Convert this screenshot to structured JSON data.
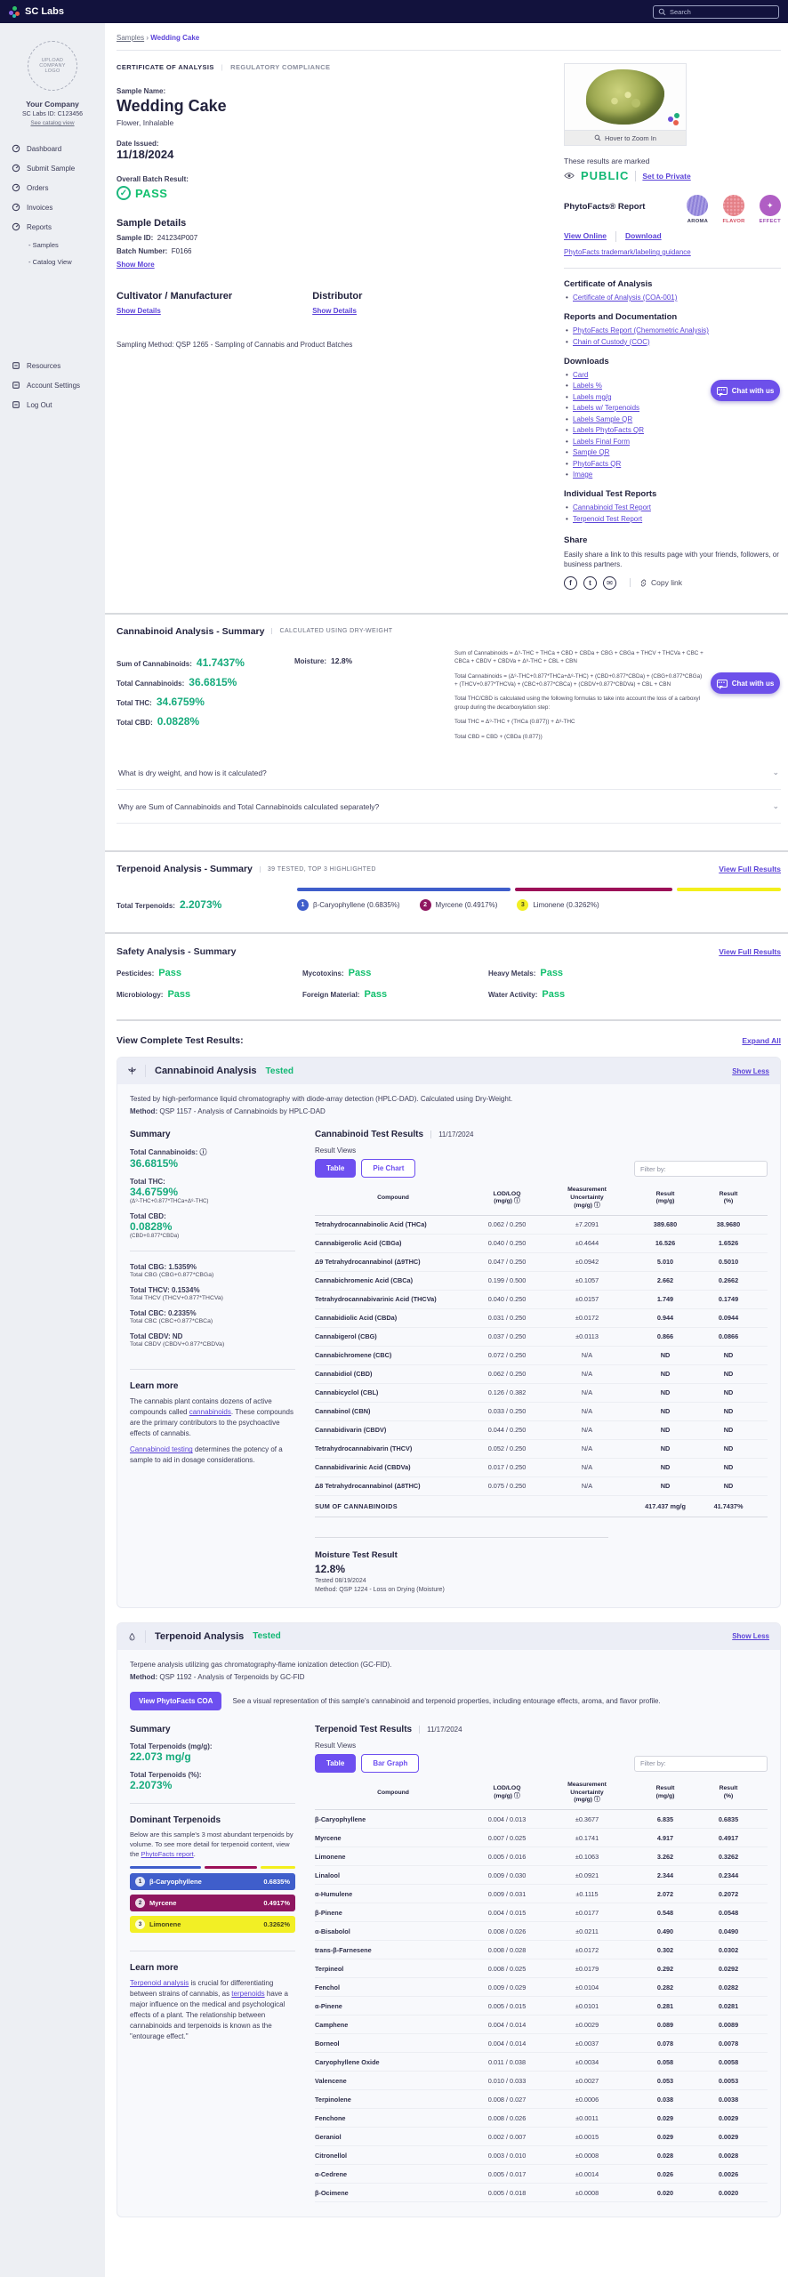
{
  "topbar": {
    "brand": "SC Labs",
    "search_placeholder": "Search"
  },
  "sidebar": {
    "upload_logo": "UPLOAD\nCOMPANY\nLOGO",
    "company": "Your Company",
    "labs_id": "SC Labs ID: C123456",
    "catalog_link": "See catalog view",
    "nav": [
      {
        "label": "Dashboard",
        "icon": "dashboard-icon"
      },
      {
        "label": "Submit Sample",
        "icon": "submit-sample-icon"
      },
      {
        "label": "Orders",
        "icon": "orders-icon"
      },
      {
        "label": "Invoices",
        "icon": "invoices-icon"
      },
      {
        "label": "Reports",
        "icon": "reports-icon"
      }
    ],
    "subnav": [
      {
        "label": "- Samples"
      },
      {
        "label": "- Catalog View"
      }
    ],
    "bottom": [
      {
        "label": "Resources"
      },
      {
        "label": "Account Settings"
      },
      {
        "label": "Log Out"
      }
    ]
  },
  "breadcrumb": {
    "parent": "Samples",
    "sep": "›",
    "current": "Wedding Cake"
  },
  "tabs": {
    "coa": "CERTIFICATE OF ANALYSIS",
    "reg": "REGULATORY COMPLIANCE"
  },
  "sample": {
    "name_label": "Sample Name:",
    "name": "Wedding Cake",
    "type": "Flower, Inhalable",
    "date_issued_label": "Date Issued:",
    "date_issued": "11/18/2024",
    "batch_result_label": "Overall Batch Result:",
    "batch_result": "PASS",
    "details_title": "Sample Details",
    "sample_id_label": "Sample ID:",
    "sample_id": "241234P007",
    "batch_number_label": "Batch Number:",
    "batch_number": "F0166",
    "show_more": "Show More",
    "cultivator_title": "Cultivator / Manufacturer",
    "distributor_title": "Distributor",
    "show_details": "Show Details",
    "sampling_method": "Sampling Method: QSP 1265 - Sampling of Cannabis and Product Batches"
  },
  "right_rail": {
    "hover_zoom": "Hover to Zoom In",
    "marked_label": "These results are marked",
    "visibility": "PUBLIC",
    "set_private": "Set to Private",
    "phytofacts_title": "PhytoFacts® Report",
    "profile_circles": [
      {
        "label": "AROMA"
      },
      {
        "label": "FLAVOR"
      },
      {
        "label": "EFFECT"
      }
    ],
    "view_online": "View Online",
    "download": "Download",
    "guidance_link": "PhytoFacts trademark/labeling guidance",
    "coa_title": "Certificate of Analysis",
    "coa_links": [
      {
        "label": "Certificate of Analysis (COA-001)"
      }
    ],
    "docs_title": "Reports and Documentation",
    "docs_links": [
      {
        "label": "PhytoFacts Report (Chemometric Analysis)"
      },
      {
        "label": "Chain of Custody (COC)"
      }
    ],
    "downloads_title": "Downloads",
    "downloads": [
      {
        "label": "Card"
      },
      {
        "label": "Labels %"
      },
      {
        "label": "Labels mg/g"
      },
      {
        "label": "Labels w/ Terpenoids"
      },
      {
        "label": "Labels Sample QR"
      },
      {
        "label": "Labels PhytoFacts QR"
      },
      {
        "label": "Labels Final Form"
      },
      {
        "label": "Sample QR"
      },
      {
        "label": "PhytoFacts QR"
      },
      {
        "label": "Image"
      }
    ],
    "reports_title": "Individual Test Reports",
    "report_links": [
      {
        "label": "Cannabinoid Test Report"
      },
      {
        "label": "Terpenoid Test Report"
      }
    ],
    "share_title": "Share",
    "share_text": "Easily share a link to this results page with your friends, followers, or business partners.",
    "copy_link": "Copy link"
  },
  "chat": {
    "label": "Chat with us"
  },
  "cannabinoid_summary": {
    "title": "Cannabinoid Analysis - Summary",
    "note": "CALCULATED USING DRY-WEIGHT",
    "stats": [
      {
        "label": "Sum of Cannabinoids:",
        "value": "41.7437%"
      },
      {
        "label": "Total Cannabinoids:",
        "value": "36.6815%"
      },
      {
        "label": "Total THC:",
        "value": "34.6759%"
      },
      {
        "label": "Total CBD:",
        "value": "0.0828%"
      }
    ],
    "moisture_label": "Moisture:",
    "moisture": "12.8%",
    "formulas": [
      {
        "text": "Sum of Cannabinoids = Δ⁹-THC + THCa + CBD + CBDa + CBG + CBGa + THCV + THCVa + CBC + CBCa + CBDV + CBDVa + Δ⁸-THC + CBL + CBN"
      },
      {
        "text": "Total Cannabinoids = (Δ⁹-THC+0.877*THCa+Δ⁸-THC) + (CBD+0.877*CBDa) + (CBG+0.877*CBGa) + (THCV+0.877*THCVa) + (CBC+0.877*CBCa) + (CBDV+0.877*CBDVa) + CBL + CBN"
      },
      {
        "text": "Total THC/CBD is calculated using the following formulas to take into account the loss of a carboxyl group during the decarboxylation step:"
      },
      {
        "text": "Total THC = Δ⁹-THC + (THCa (0.877)) + Δ⁸-THC"
      },
      {
        "text": "Total CBD = CBD + (CBDa (0.877))"
      }
    ]
  },
  "faq": [
    {
      "q": "What is dry weight, and how is it calculated?"
    },
    {
      "q": "Why are Sum of Cannabinoids and Total Cannabinoids calculated separately?"
    }
  ],
  "terpenoid_summary": {
    "title": "Terpenoid Analysis - Summary",
    "note": "39 TESTED, TOP 3 HIGHLIGHTED",
    "link": "View Full Results",
    "total_label": "Total Terpenoids:",
    "total": "2.2073%",
    "segments": [
      {
        "color": "#3f5ecb",
        "width": "45%"
      },
      {
        "color": "#9c1058",
        "width": "33%"
      },
      {
        "color": "#f3ef1c",
        "width": "22%"
      }
    ],
    "badges": [
      {
        "rank": "1",
        "text": "β-Caryophyllene (0.6835%)",
        "color": "#3f5ecb",
        "fg": "#ffffff"
      },
      {
        "rank": "2",
        "text": "Myrcene (0.4917%)",
        "color": "#8f1760",
        "fg": "#ffffff"
      },
      {
        "rank": "3",
        "text": "Limonene (0.3262%)",
        "color": "#f2ef25",
        "fg": "#44441a"
      }
    ]
  },
  "safety_summary": {
    "title": "Safety Analysis - Summary",
    "link": "View Full Results",
    "items": [
      {
        "label": "Pesticides:",
        "value": "Pass"
      },
      {
        "label": "Mycotoxins:",
        "value": "Pass"
      },
      {
        "label": "Heavy Metals:",
        "value": "Pass"
      },
      {
        "label": "Microbiology:",
        "value": "Pass"
      },
      {
        "label": "Foreign Material:",
        "value": "Pass"
      },
      {
        "label": "Water Activity:",
        "value": "Pass"
      }
    ]
  },
  "complete_results": {
    "title": "View Complete Test Results:",
    "expand": "Expand All"
  },
  "cannabinoid_panel": {
    "title": "Cannabinoid Analysis",
    "status": "Tested",
    "toggle": "Show Less",
    "desc": "Tested by high-performance liquid chromatography with diode-array detection (HPLC-DAD). Calculated using Dry-Weight.",
    "method_label": "Method:",
    "method": "QSP 1157 - Analysis of Cannabinoids by HPLC-DAD",
    "summary_title": "Summary",
    "totals": [
      {
        "label": "Total Cannabinoids: ⓘ",
        "value": "36.6815%",
        "formula": ""
      },
      {
        "label": "Total THC:",
        "value": "34.6759%",
        "formula": "(Δ⁹-THC+0.877*THCa+Δ⁸-THC)"
      },
      {
        "label": "Total CBD:",
        "value": "0.0828%",
        "formula": "(CBD+0.877*CBDa)"
      }
    ],
    "minor_totals": [
      {
        "label": "Total CBG:",
        "value": "1.5359%",
        "formula": "Total CBG (CBG+0.877*CBGa)"
      },
      {
        "label": "Total THCV:",
        "value": "0.1534%",
        "formula": "Total THCV (THCV+0.877*THCVa)"
      },
      {
        "label": "Total CBC:",
        "value": "0.2335%",
        "formula": "Total CBC (CBC+0.877*CBCa)"
      },
      {
        "label": "Total CBDV:",
        "value": "ND",
        "formula": "Total CBDV (CBDV+0.877*CBDVa)"
      }
    ],
    "learn_title": "Learn more",
    "learn_p1_pre": "The cannabis plant contains dozens of active compounds called ",
    "learn_p1_link": "cannabinoids",
    "learn_p1_post": ". These compounds are the primary contributors to the psychoactive effects of cannabis.",
    "learn_p2_link": "Cannabinoid testing",
    "learn_p2_post": " determines the potency of a sample to aid in dosage considerations.",
    "results_title": "Cannabinoid Test Results",
    "date": "11/17/2024",
    "views_label": "Result Views",
    "view_buttons": [
      {
        "label": "Table"
      },
      {
        "label": "Pie Chart"
      }
    ],
    "filter_placeholder": "Filter by:",
    "table": {
      "headers": [
        {
          "text": "Compound"
        },
        {
          "text": "LOD/LOQ\n(mg/g) ⓘ"
        },
        {
          "text": "Measurement\nUncertainty\n(mg/g) ⓘ"
        },
        {
          "text": "Result\n(mg/g)"
        },
        {
          "text": "Result\n(%)"
        }
      ],
      "rows": [
        [
          "Tetrahydrocannabinolic Acid (THCa)",
          "0.062 / 0.250",
          "±7.2091",
          "389.680",
          "38.9680"
        ],
        [
          "Cannabigerolic Acid (CBGa)",
          "0.040 / 0.250",
          "±0.4644",
          "16.526",
          "1.6526"
        ],
        [
          "Δ9 Tetrahydrocannabinol (Δ9THC)",
          "0.047 / 0.250",
          "±0.0942",
          "5.010",
          "0.5010"
        ],
        [
          "Cannabichromenic Acid (CBCa)",
          "0.199 / 0.500",
          "±0.1057",
          "2.662",
          "0.2662"
        ],
        [
          "Tetrahydrocannabivarinic Acid (THCVa)",
          "0.040 / 0.250",
          "±0.0157",
          "1.749",
          "0.1749"
        ],
        [
          "Cannabidiolic Acid (CBDa)",
          "0.031 / 0.250",
          "±0.0172",
          "0.944",
          "0.0944"
        ],
        [
          "Cannabigerol (CBG)",
          "0.037 / 0.250",
          "±0.0113",
          "0.866",
          "0.0866"
        ],
        [
          "Cannabichromene (CBC)",
          "0.072 / 0.250",
          "N/A",
          "ND",
          "ND"
        ],
        [
          "Cannabidiol (CBD)",
          "0.062 / 0.250",
          "N/A",
          "ND",
          "ND"
        ],
        [
          "Cannabicyclol (CBL)",
          "0.126 / 0.382",
          "N/A",
          "ND",
          "ND"
        ],
        [
          "Cannabinol (CBN)",
          "0.033 / 0.250",
          "N/A",
          "ND",
          "ND"
        ],
        [
          "Cannabidivarin (CBDV)",
          "0.044 / 0.250",
          "N/A",
          "ND",
          "ND"
        ],
        [
          "Tetrahydrocannabivarin (THCV)",
          "0.052 / 0.250",
          "N/A",
          "ND",
          "ND"
        ],
        [
          "Cannabidivarinic Acid (CBDVa)",
          "0.017 / 0.250",
          "N/A",
          "ND",
          "ND"
        ],
        [
          "Δ8 Tetrahydrocannabinol (Δ8THC)",
          "0.075 / 0.250",
          "N/A",
          "ND",
          "ND"
        ]
      ],
      "sum_label": "SUM OF CANNABINOIDS",
      "sum_mgg": "417.437 mg/g",
      "sum_pct": "41.7437%"
    },
    "moisture_title": "Moisture Test Result",
    "moisture_value": "12.8%",
    "moisture_tested": "Tested 08/19/2024",
    "moisture_method": "Method: QSP 1224 - Loss on Drying (Moisture)"
  },
  "terpenoid_panel": {
    "title": "Terpenoid Analysis",
    "status": "Tested",
    "toggle": "Show Less",
    "desc": "Terpene analysis utilizing gas chromatography-flame ionization detection (GC-FID).",
    "method_label": "Method:",
    "method": "QSP 1192 - Analysis of Terpenoids by GC-FID",
    "phyto_button": "View PhytoFacts COA",
    "phyto_note": "See a visual representation of this sample's cannabinoid and terpenoid properties, including entourage effects, aroma, and flavor profile.",
    "summary_title": "Summary",
    "total_mgg_label": "Total Terpenoids (mg/g):",
    "total_mgg": "22.073 mg/g",
    "total_pct_label": "Total Terpenoids (%):",
    "total_pct": "2.2073%",
    "dominant_title": "Dominant Terpenoids",
    "dominant_desc_pre": "Below are this sample's 3 most abundant terpenoids by volume. To see more detail for terpenoid content, view the ",
    "dominant_desc_link": "PhytoFacts report",
    "dominant_desc_post": ".",
    "dominant_segments": [
      {
        "color": "#3f5ecb",
        "width": "45%"
      },
      {
        "color": "#9c1058",
        "width": "33%"
      },
      {
        "color": "#f3ef1c",
        "width": "22%"
      }
    ],
    "dominant_bars": [
      {
        "rank": "1",
        "name": "β-Caryophyllene",
        "pct": "0.6835%",
        "color": "#3f5ecb",
        "fg": "#ffffff"
      },
      {
        "rank": "2",
        "name": "Myrcene",
        "pct": "0.4917%",
        "color": "#8f1760",
        "fg": "#ffffff"
      },
      {
        "rank": "3",
        "name": "Limonene",
        "pct": "0.3262%",
        "color": "#f2ef25",
        "fg": "#44441a"
      }
    ],
    "learn_title": "Learn more",
    "learn_link1": "Terpenoid analysis",
    "learn_t1": " is crucial for differentiating between strains of cannabis, as ",
    "learn_link2": "terpenoids",
    "learn_t2": " have a major influence on the medical and psychological effects of a plant. The relationship between cannabinoids and terpenoids is known as the \"entourage effect.\"",
    "results_title": "Terpenoid Test Results",
    "date": "11/17/2024",
    "views_label": "Result Views",
    "view_buttons": [
      {
        "label": "Table"
      },
      {
        "label": "Bar Graph"
      }
    ],
    "filter_placeholder": "Filter by:",
    "table": {
      "headers": [
        {
          "text": "Compound"
        },
        {
          "text": "LOD/LOQ\n(mg/g) ⓘ"
        },
        {
          "text": "Measurement\nUncertainty\n(mg/g) ⓘ"
        },
        {
          "text": "Result\n(mg/g)"
        },
        {
          "text": "Result\n(%)"
        }
      ],
      "rows": [
        [
          "β-Caryophyllene",
          "0.004 / 0.013",
          "±0.3677",
          "6.835",
          "0.6835"
        ],
        [
          "Myrcene",
          "0.007 / 0.025",
          "±0.1741",
          "4.917",
          "0.4917"
        ],
        [
          "Limonene",
          "0.005 / 0.016",
          "±0.1063",
          "3.262",
          "0.3262"
        ],
        [
          "Linalool",
          "0.009 / 0.030",
          "±0.0921",
          "2.344",
          "0.2344"
        ],
        [
          "α-Humulene",
          "0.009 / 0.031",
          "±0.1115",
          "2.072",
          "0.2072"
        ],
        [
          "β-Pinene",
          "0.004 / 0.015",
          "±0.0177",
          "0.548",
          "0.0548"
        ],
        [
          "α-Bisabolol",
          "0.008 / 0.026",
          "±0.0211",
          "0.490",
          "0.0490"
        ],
        [
          "trans-β-Farnesene",
          "0.008 / 0.028",
          "±0.0172",
          "0.302",
          "0.0302"
        ],
        [
          "Terpineol",
          "0.008 / 0.025",
          "±0.0179",
          "0.292",
          "0.0292"
        ],
        [
          "Fenchol",
          "0.009 / 0.029",
          "±0.0104",
          "0.282",
          "0.0282"
        ],
        [
          "α-Pinene",
          "0.005 / 0.015",
          "±0.0101",
          "0.281",
          "0.0281"
        ],
        [
          "Camphene",
          "0.004 / 0.014",
          "±0.0029",
          "0.089",
          "0.0089"
        ],
        [
          "Borneol",
          "0.004 / 0.014",
          "±0.0037",
          "0.078",
          "0.0078"
        ],
        [
          "Caryophyllene Oxide",
          "0.011 / 0.038",
          "±0.0034",
          "0.058",
          "0.0058"
        ],
        [
          "Valencene",
          "0.010 / 0.033",
          "±0.0027",
          "0.053",
          "0.0053"
        ],
        [
          "Terpinolene",
          "0.008 / 0.027",
          "±0.0006",
          "0.038",
          "0.0038"
        ],
        [
          "Fenchone",
          "0.008 / 0.026",
          "±0.0011",
          "0.029",
          "0.0029"
        ],
        [
          "Geraniol",
          "0.002 / 0.007",
          "±0.0015",
          "0.029",
          "0.0029"
        ],
        [
          "Citronellol",
          "0.003 / 0.010",
          "±0.0008",
          "0.028",
          "0.0028"
        ],
        [
          "α-Cedrene",
          "0.005 / 0.017",
          "±0.0014",
          "0.026",
          "0.0026"
        ],
        [
          "β-Ocimene",
          "0.005 / 0.018",
          "±0.0008",
          "0.020",
          "0.0020"
        ]
      ]
    }
  }
}
